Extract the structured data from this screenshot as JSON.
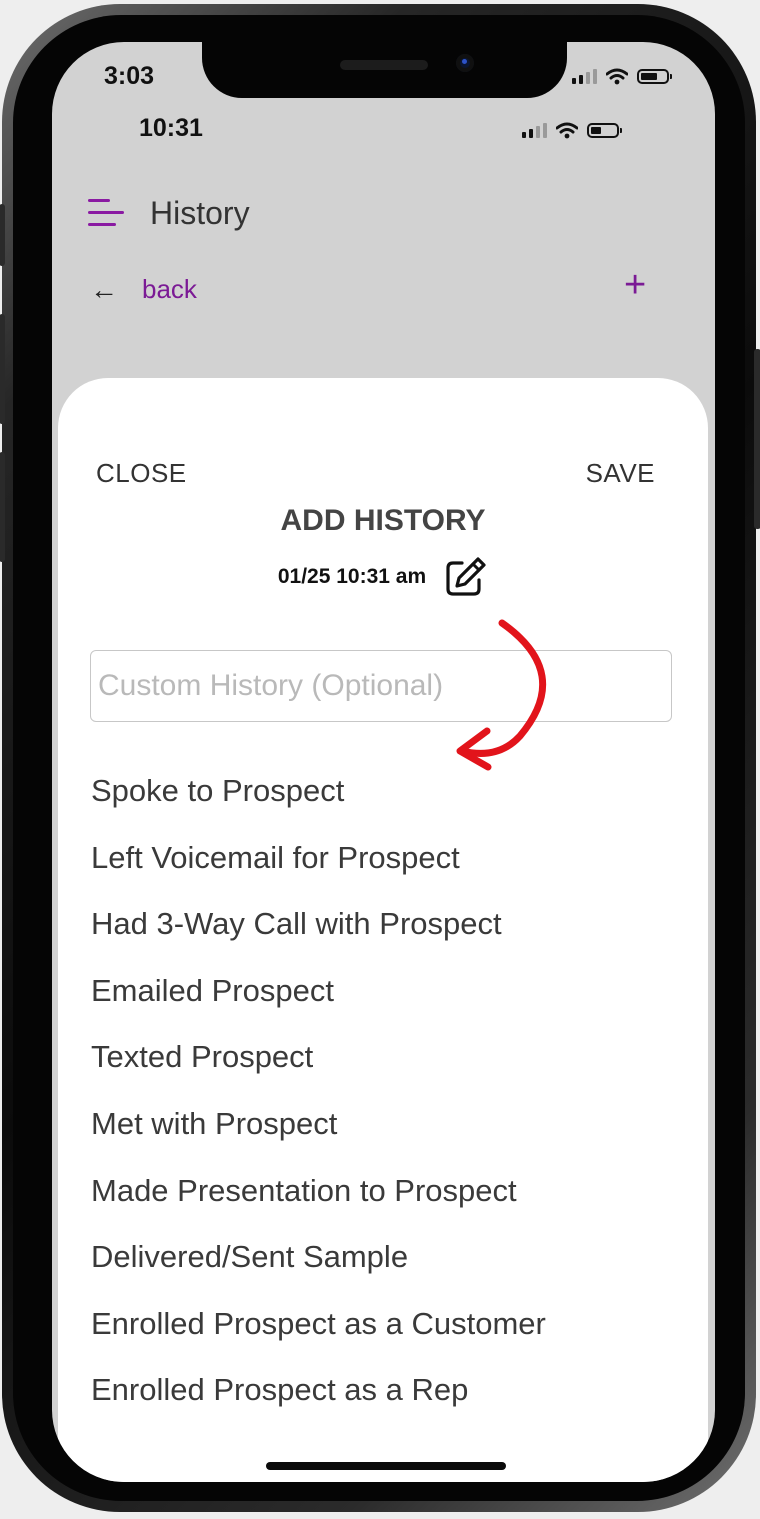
{
  "outer_status_bar": {
    "time": "3:03"
  },
  "status_bar": {
    "time": "10:31"
  },
  "header": {
    "title": "History",
    "back_label": "back",
    "back_arrow": "←",
    "add_symbol": "+"
  },
  "sheet": {
    "close_label": "CLOSE",
    "save_label": "SAVE",
    "title": "ADD HISTORY",
    "datetime": "01/25 10:31 am",
    "custom_input": {
      "placeholder": "Custom History (Optional)",
      "value": ""
    },
    "options": [
      "Spoke to Prospect",
      "Left Voicemail for Prospect",
      "Had 3-Way Call with Prospect",
      "Emailed Prospect",
      "Texted Prospect",
      "Met with Prospect",
      "Made Presentation to Prospect",
      "Delivered/Sent Sample",
      "Enrolled Prospect as a Customer",
      "Enrolled Prospect as a Rep"
    ]
  },
  "icons": {
    "menu": "hamburger-menu-icon",
    "back": "arrow-left-icon",
    "add": "plus-icon",
    "edit": "edit-pencil-icon",
    "annotation": "curved-arrow-annotation"
  },
  "colors": {
    "accent": "#7b1a95",
    "header_background": "#d2d2d2",
    "sheet_background": "#ffffff",
    "annotation_arrow": "#e2141b"
  }
}
